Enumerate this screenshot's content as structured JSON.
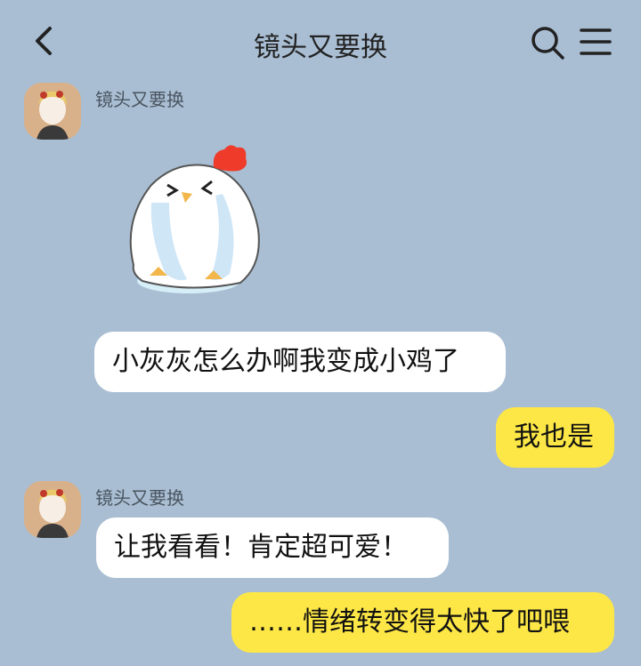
{
  "header": {
    "title": "镜头又要换"
  },
  "messages": [
    {
      "sender": "镜头又要换",
      "type": "sticker",
      "sticker": "crying-chick-sticker"
    },
    {
      "sender": "镜头又要换",
      "type": "text",
      "text": "小灰灰怎么办啊我变成小鸡了"
    },
    {
      "sender": "me",
      "type": "text",
      "text": "我也是"
    },
    {
      "sender": "镜头又要换",
      "type": "text",
      "text": "让我看看！肯定超可爱！"
    },
    {
      "sender": "me",
      "type": "text",
      "text": "……情绪转变得太快了吧喂"
    }
  ],
  "colors": {
    "background": "#a9bed3",
    "incoming_bubble": "#ffffff",
    "outgoing_bubble": "#fde746"
  },
  "icons": [
    "back-arrow-icon",
    "search-icon",
    "menu-icon"
  ]
}
